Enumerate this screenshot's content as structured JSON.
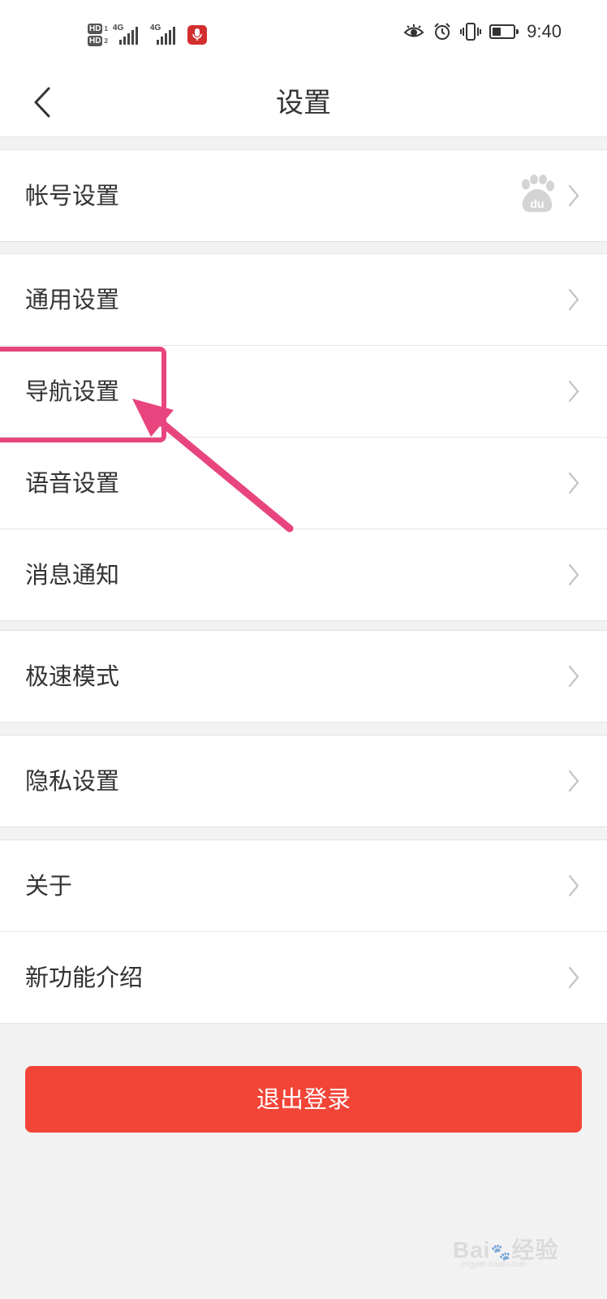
{
  "status_bar": {
    "sim1": {
      "badge": "HD",
      "slot": "1",
      "network": "4G"
    },
    "sim2": {
      "badge": "HD",
      "slot": "2",
      "network": "4G"
    },
    "time": "9:40",
    "battery_level": 0.4,
    "icons": [
      "eye-comfort-icon",
      "alarm-icon",
      "vibrate-icon",
      "battery-icon",
      "mic-icon"
    ]
  },
  "nav": {
    "title": "设置"
  },
  "groups": [
    {
      "items": [
        {
          "label": "帐号设置",
          "trailing_icon": "baidu-paw-icon"
        }
      ]
    },
    {
      "items": [
        {
          "label": "通用设置"
        },
        {
          "label": "导航设置"
        },
        {
          "label": "语音设置"
        },
        {
          "label": "消息通知"
        }
      ]
    },
    {
      "items": [
        {
          "label": "极速模式"
        }
      ]
    },
    {
      "items": [
        {
          "label": "隐私设置"
        }
      ]
    },
    {
      "items": [
        {
          "label": "关于"
        },
        {
          "label": "新功能介绍"
        }
      ]
    }
  ],
  "logout_label": "退出登录",
  "watermark": {
    "brand": "Bai",
    "site": "经验",
    "url": "jingyan.baidu.com"
  },
  "colors": {
    "accent": "#f24537",
    "annotation": "#e8457f",
    "background": "#f2f2f2"
  }
}
